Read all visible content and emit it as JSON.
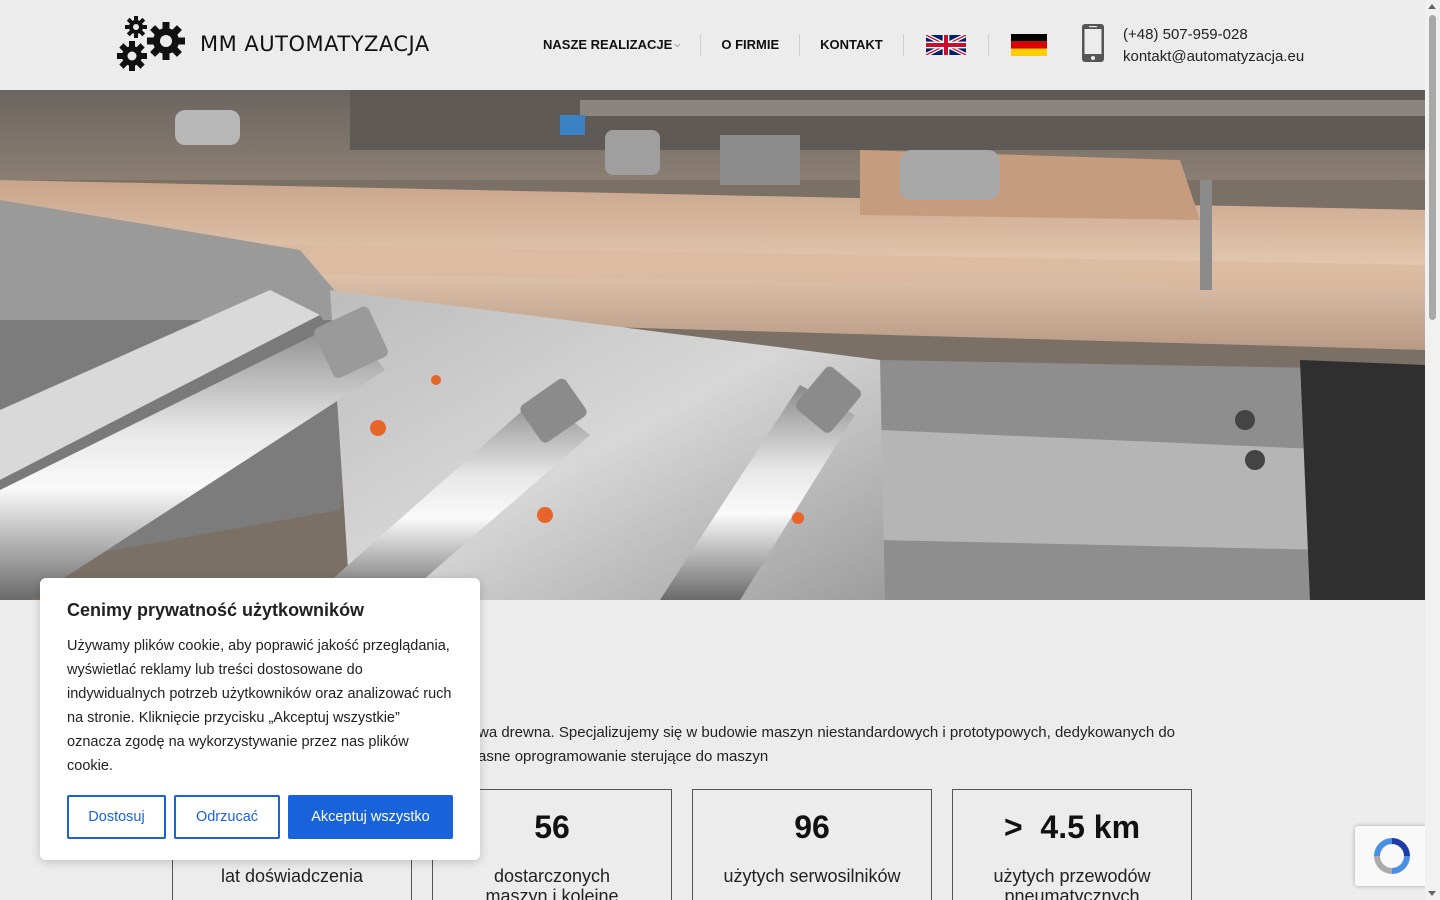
{
  "header": {
    "logo_text": "MM AUTOMATYZACJA",
    "nav": [
      {
        "label": "NASZE REALIZACJE",
        "has_dropdown": true
      },
      {
        "label": "O FIRMIE"
      },
      {
        "label": "KONTAKT"
      }
    ],
    "languages": [
      {
        "icon": "uk-flag-icon"
      },
      {
        "icon": "de-flag-icon"
      }
    ],
    "contact": {
      "phone": "(+48) 507-959-028",
      "email": "kontakt@automatyzacja.eu"
    }
  },
  "intro": {
    "line1": "wa drewna. Specjalizujemy się w budowie maszyn niestandardowych i prototypowych, dedykowanych do",
    "line2": "asne oprogramowanie sterujące do maszyn"
  },
  "stats": [
    {
      "value": "",
      "label": "lat doświadczenia"
    },
    {
      "value": "56",
      "label": "dostarczonych maszyn i kolejne w budowie"
    },
    {
      "value": "96",
      "label": "użytych serwosilników"
    },
    {
      "value": ">  4.5 km",
      "label": "użytych przewodów pneumatycznych"
    }
  ],
  "cookie": {
    "title": "Cenimy prywatność użytkowników",
    "text": "Używamy plików cookie, aby poprawić jakość przeglądania, wyświetlać reklamy lub treści dostosowane do indywidualnych potrzeb użytkowników oraz analizować ruch na stronie. Kliknięcie przycisku „Akceptuj wszystkie” oznacza zgodę na wykorzystywanie przez nas plików cookie.",
    "btn_customize": "Dostosuj",
    "btn_reject": "Odrzucać",
    "btn_accept": "Akceptuj wszystko"
  },
  "colors": {
    "accent": "#1863dc",
    "background": "#ececec"
  }
}
